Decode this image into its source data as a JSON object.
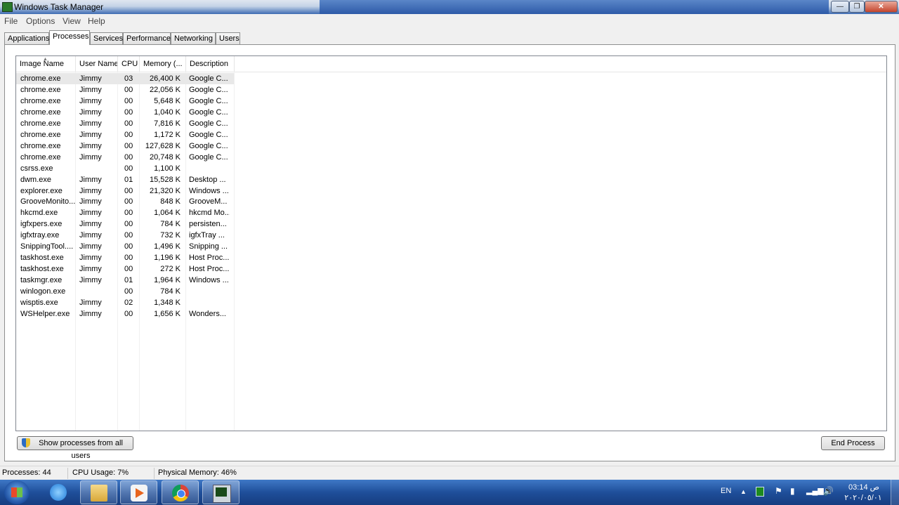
{
  "window": {
    "title": "Windows Task Manager",
    "min_glyph": "—",
    "max_glyph": "❐",
    "close_glyph": "✕"
  },
  "menu": [
    "File",
    "Options",
    "View",
    "Help"
  ],
  "tabs": [
    "Applications",
    "Processes",
    "Services",
    "Performance",
    "Networking",
    "Users"
  ],
  "active_tab": "Processes",
  "columns": [
    "Image Name",
    "User Name",
    "CPU",
    "Memory (...",
    "Description"
  ],
  "processes": [
    {
      "name": "chrome.exe",
      "user": "Jimmy",
      "cpu": "03",
      "mem": "26,400 K",
      "desc": "Google C..."
    },
    {
      "name": "chrome.exe",
      "user": "Jimmy",
      "cpu": "00",
      "mem": "22,056 K",
      "desc": "Google C..."
    },
    {
      "name": "chrome.exe",
      "user": "Jimmy",
      "cpu": "00",
      "mem": "5,648 K",
      "desc": "Google C..."
    },
    {
      "name": "chrome.exe",
      "user": "Jimmy",
      "cpu": "00",
      "mem": "1,040 K",
      "desc": "Google C..."
    },
    {
      "name": "chrome.exe",
      "user": "Jimmy",
      "cpu": "00",
      "mem": "7,816 K",
      "desc": "Google C..."
    },
    {
      "name": "chrome.exe",
      "user": "Jimmy",
      "cpu": "00",
      "mem": "1,172 K",
      "desc": "Google C..."
    },
    {
      "name": "chrome.exe",
      "user": "Jimmy",
      "cpu": "00",
      "mem": "127,628 K",
      "desc": "Google C..."
    },
    {
      "name": "chrome.exe",
      "user": "Jimmy",
      "cpu": "00",
      "mem": "20,748 K",
      "desc": "Google C..."
    },
    {
      "name": "csrss.exe",
      "user": "",
      "cpu": "00",
      "mem": "1,100 K",
      "desc": ""
    },
    {
      "name": "dwm.exe",
      "user": "Jimmy",
      "cpu": "01",
      "mem": "15,528 K",
      "desc": "Desktop ..."
    },
    {
      "name": "explorer.exe",
      "user": "Jimmy",
      "cpu": "00",
      "mem": "21,320 K",
      "desc": "Windows ..."
    },
    {
      "name": "GrooveMonito...",
      "user": "Jimmy",
      "cpu": "00",
      "mem": "848 K",
      "desc": "GrooveM..."
    },
    {
      "name": "hkcmd.exe",
      "user": "Jimmy",
      "cpu": "00",
      "mem": "1,064 K",
      "desc": "hkcmd Mo..."
    },
    {
      "name": "igfxpers.exe",
      "user": "Jimmy",
      "cpu": "00",
      "mem": "784 K",
      "desc": "persisten..."
    },
    {
      "name": "igfxtray.exe",
      "user": "Jimmy",
      "cpu": "00",
      "mem": "732 K",
      "desc": "igfxTray ..."
    },
    {
      "name": "SnippingTool....",
      "user": "Jimmy",
      "cpu": "00",
      "mem": "1,496 K",
      "desc": "Snipping ..."
    },
    {
      "name": "taskhost.exe",
      "user": "Jimmy",
      "cpu": "00",
      "mem": "1,196 K",
      "desc": "Host Proc..."
    },
    {
      "name": "taskhost.exe",
      "user": "Jimmy",
      "cpu": "00",
      "mem": "272 K",
      "desc": "Host Proc..."
    },
    {
      "name": "taskmgr.exe",
      "user": "Jimmy",
      "cpu": "01",
      "mem": "1,964 K",
      "desc": "Windows ..."
    },
    {
      "name": "winlogon.exe",
      "user": "",
      "cpu": "00",
      "mem": "784 K",
      "desc": ""
    },
    {
      "name": "wisptis.exe",
      "user": "Jimmy",
      "cpu": "02",
      "mem": "1,348 K",
      "desc": ""
    },
    {
      "name": "WSHelper.exe",
      "user": "Jimmy",
      "cpu": "00",
      "mem": "1,656 K",
      "desc": "Wonders..."
    }
  ],
  "buttons": {
    "show_all": "Show processes from all users",
    "end_process": "End Process"
  },
  "status": {
    "processes": "Processes: 44",
    "cpu": "CPU Usage: 7%",
    "memory": "Physical Memory: 46%"
  },
  "taskbar": {
    "items": [
      "start-orb-icon",
      "internet-explorer-icon",
      "file-explorer-icon",
      "media-player-icon",
      "chrome-icon",
      "task-manager-icon"
    ],
    "language": "EN",
    "tray_icons": [
      "show-hidden-icons-icon",
      "green-app-icon",
      "action-center-flag-icon",
      "power-icon",
      "network-signal-icon",
      "volume-icon"
    ],
    "time": "03:14 ص",
    "date": "٢٠٢٠/٠٥/٠١"
  },
  "colors": {
    "taskbar": "#1f4f9a",
    "titlebar": "#3d6bb3",
    "selected_row": "#e8e8e8"
  }
}
